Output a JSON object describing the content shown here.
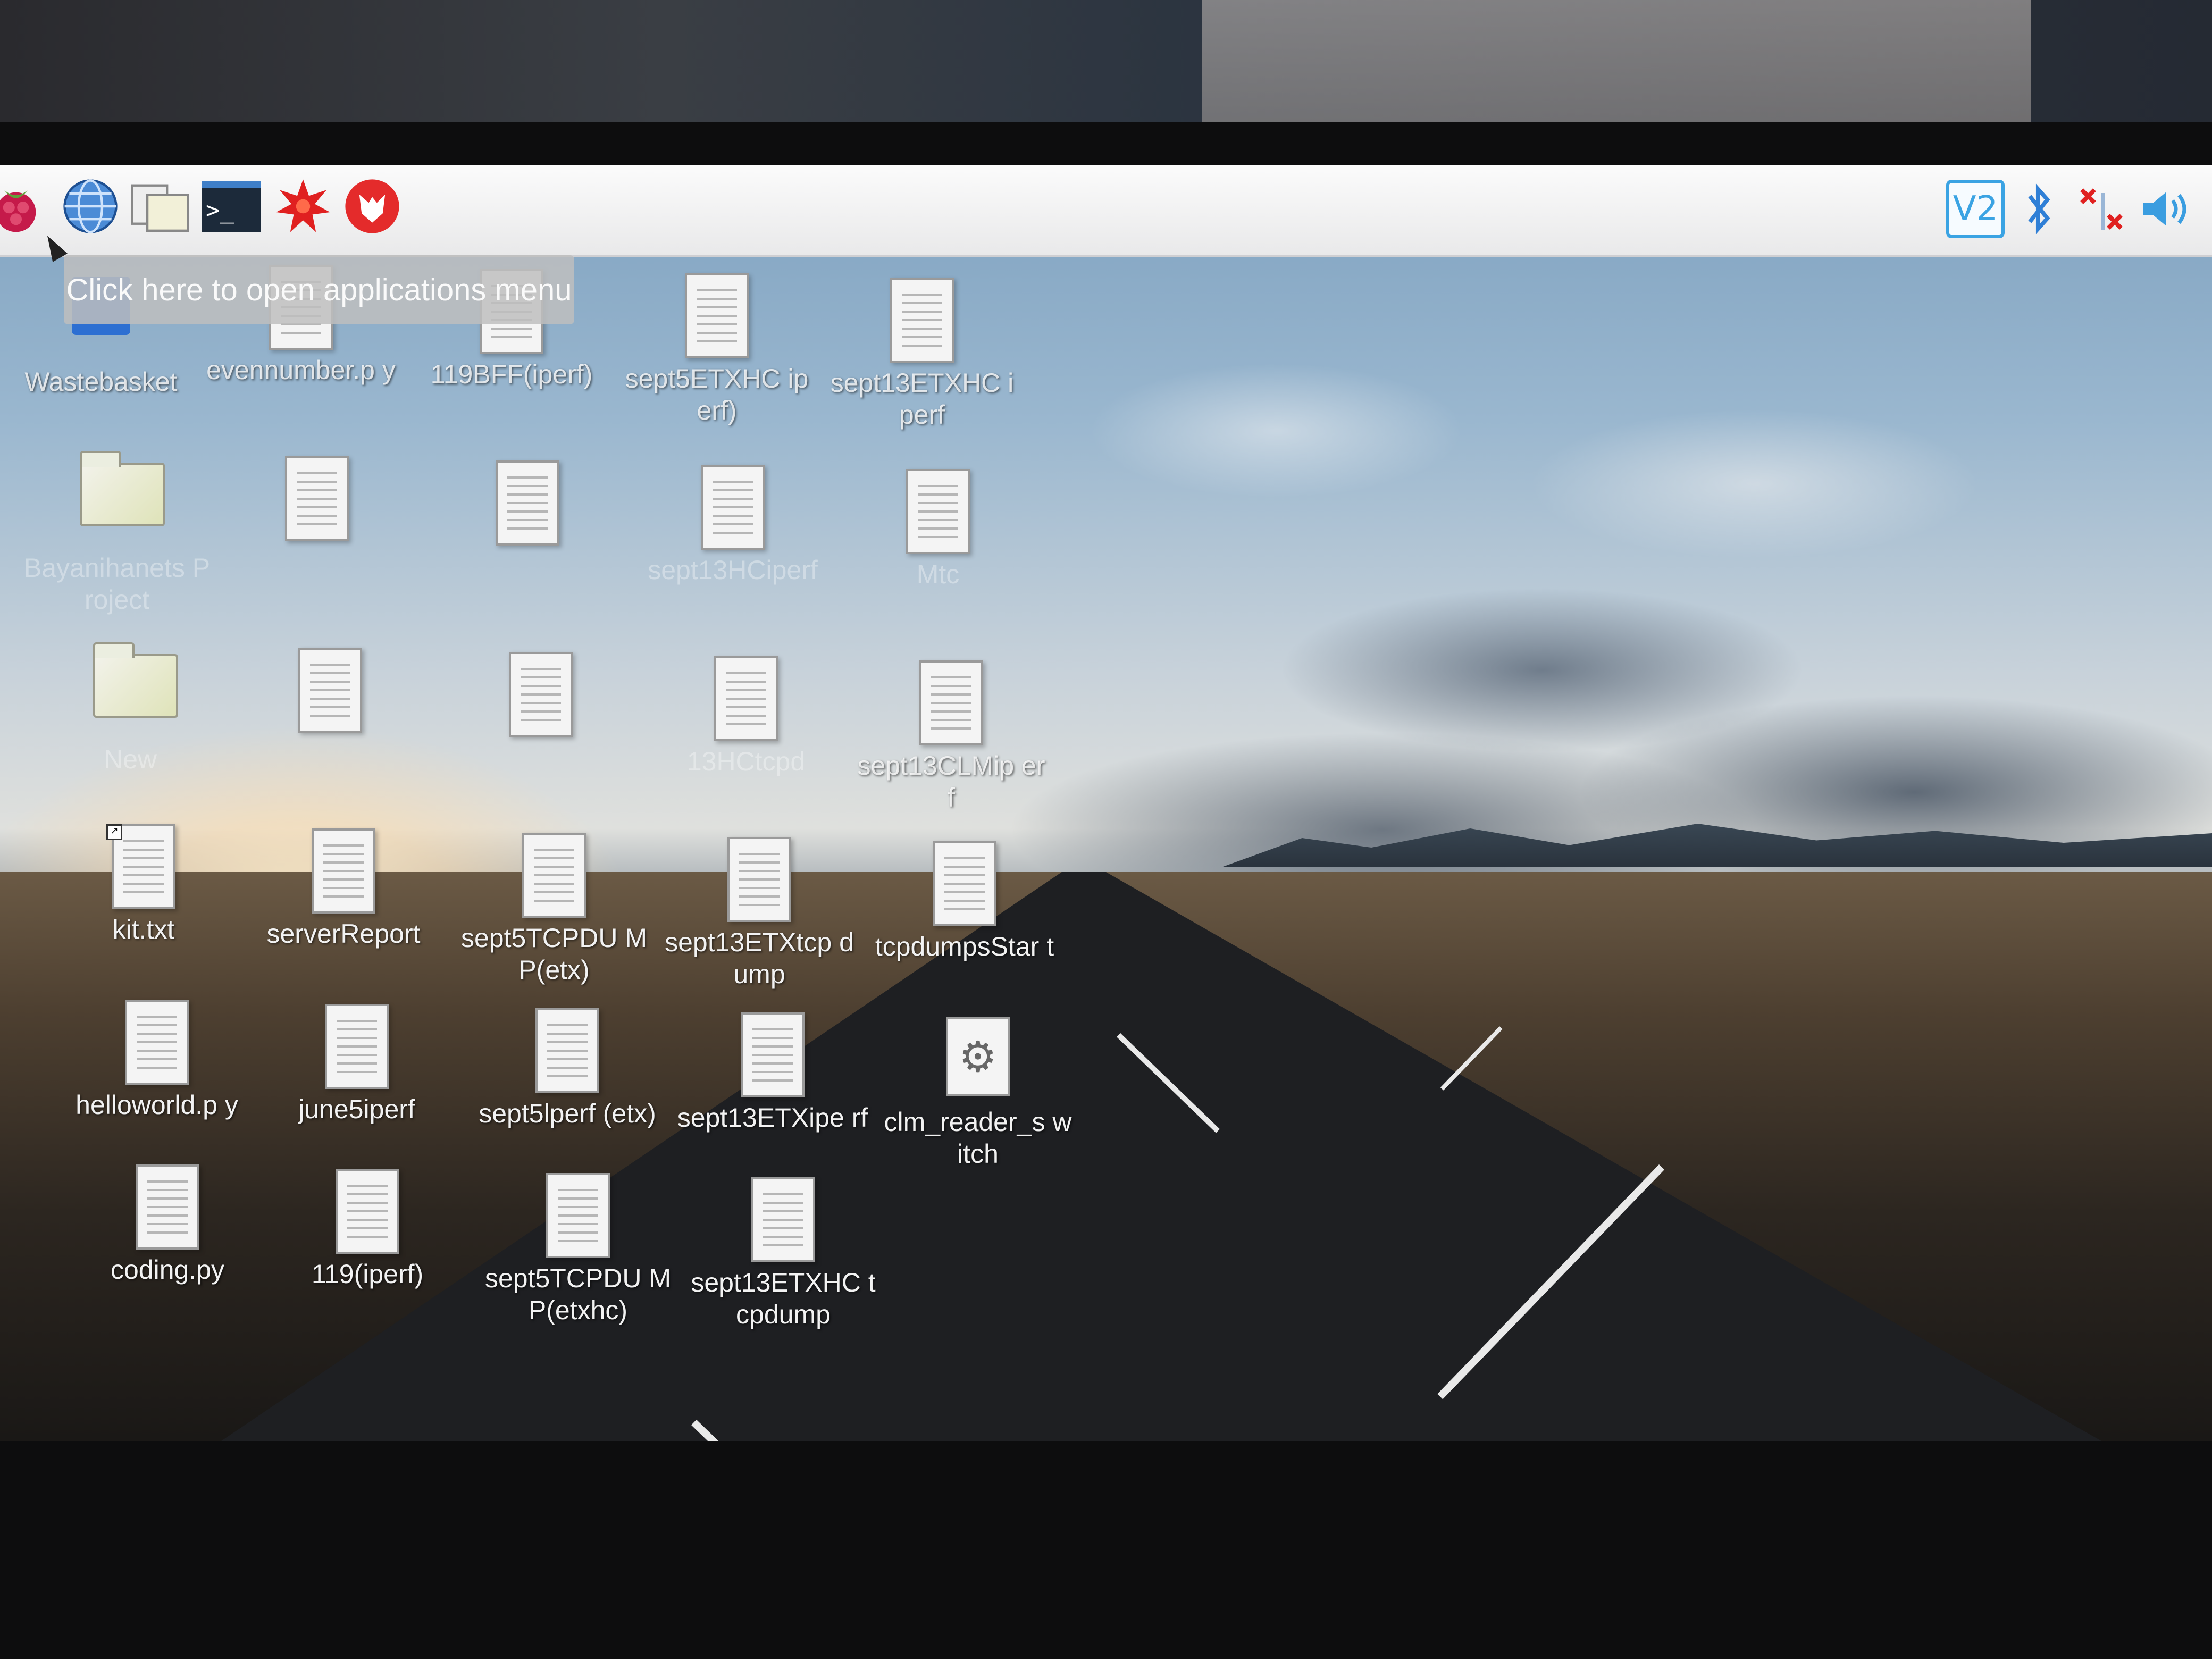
{
  "taskbar": {
    "apps": [
      {
        "name": "raspberry-menu-icon"
      },
      {
        "name": "web-browser-icon"
      },
      {
        "name": "file-manager-icon"
      },
      {
        "name": "terminal-icon"
      },
      {
        "name": "mathematica-icon"
      },
      {
        "name": "wolfram-icon"
      }
    ],
    "tray": {
      "vnc_label": "V2",
      "icons": [
        "vnc-icon",
        "bluetooth-icon",
        "network-disconnected-icon",
        "volume-icon"
      ]
    },
    "terminal_glyph": ">_"
  },
  "tooltip": {
    "text": "Click here to open applications menu"
  },
  "desktop": {
    "icons": [
      {
        "label": "Wastebasket",
        "type": "trash",
        "style": "light"
      },
      {
        "label": "evennumber.p y",
        "type": "file",
        "style": "light"
      },
      {
        "label": "119BFF(iperf)",
        "type": "file",
        "style": "light"
      },
      {
        "label": "sept5ETXHC iperf)",
        "type": "file",
        "style": "light"
      },
      {
        "label": "sept13ETXHC iperf",
        "type": "file",
        "style": "light"
      },
      {
        "label": "Bayanihanets Project",
        "type": "folder",
        "style": "faded"
      },
      {
        "label": "",
        "type": "file",
        "style": "faded"
      },
      {
        "label": "",
        "type": "file",
        "style": "faded"
      },
      {
        "label": "sept13HCiperf",
        "type": "file",
        "style": "faded"
      },
      {
        "label": "Mtc",
        "type": "file",
        "style": "faded"
      },
      {
        "label": "New",
        "type": "folder",
        "style": "faded"
      },
      {
        "label": "",
        "type": "file",
        "style": "faded"
      },
      {
        "label": "",
        "type": "file",
        "style": "faded"
      },
      {
        "label": "13HCtcpd",
        "type": "file",
        "style": "faded"
      },
      {
        "label": "sept13CLMip erf",
        "type": "file",
        "style": "light"
      },
      {
        "label": "kit.txt",
        "type": "file",
        "style": "normal",
        "shortcut": true
      },
      {
        "label": "serverReport",
        "type": "file",
        "style": "normal"
      },
      {
        "label": "sept5TCPDU MP(etx)",
        "type": "file",
        "style": "normal"
      },
      {
        "label": "sept13ETXtcp dump",
        "type": "file",
        "style": "normal"
      },
      {
        "label": "tcpdumpsStar t",
        "type": "file",
        "style": "normal"
      },
      {
        "label": "helloworld.p y",
        "type": "file",
        "style": "normal"
      },
      {
        "label": "june5iperf",
        "type": "file",
        "style": "normal"
      },
      {
        "label": "sept5lperf (etx)",
        "type": "file",
        "style": "normal"
      },
      {
        "label": "sept13ETXipe rf",
        "type": "file",
        "style": "normal"
      },
      {
        "label": "clm_reader_s witch",
        "type": "exec",
        "style": "normal"
      },
      {
        "label": "coding.py",
        "type": "file",
        "style": "normal"
      },
      {
        "label": "119(iperf)",
        "type": "file",
        "style": "normal"
      },
      {
        "label": "sept5TCPDU MP(etxhc)",
        "type": "file",
        "style": "normal"
      },
      {
        "label": "sept13ETXHC tcpdump",
        "type": "file",
        "style": "normal"
      }
    ]
  },
  "colors": {
    "accent": "#3aa3e3",
    "panel": "#f4f4f4"
  }
}
